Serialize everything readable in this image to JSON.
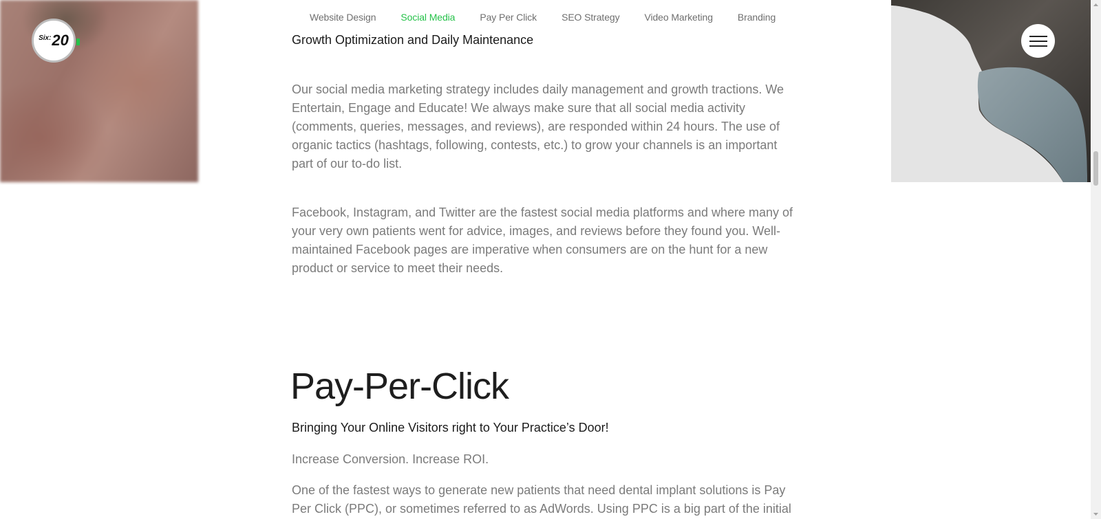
{
  "logo": {
    "prefix": "Six:",
    "number": "20"
  },
  "nav": {
    "items": [
      {
        "label": "Website Design"
      },
      {
        "label": "Social Media"
      },
      {
        "label": "Pay Per Click"
      },
      {
        "label": "SEO Strategy"
      },
      {
        "label": "Video Marketing"
      },
      {
        "label": "Branding"
      }
    ],
    "active_index": 1,
    "active_color": "#26c24a"
  },
  "menu_button": {
    "icon": "hamburger-icon"
  },
  "social_section": {
    "subheading": "Growth Optimization and Daily Maintenance",
    "paragraph_1": "Our social media marketing strategy includes daily management and growth tractions. We Entertain, Engage and Educate! We always make sure that all social media activity (comments, queries, messages, and reviews), are responded within 24 hours. The use of organic tactics (hashtags, following, contests, etc.) to grow your channels is an important part of our to-do list.",
    "paragraph_2": "Facebook, Instagram, and Twitter are the fastest social media platforms and where many of your very own patients went for advice, images, and reviews before they found you. Well-maintained Facebook pages are imperative when consumers are on the hunt for a new product or service to meet their needs."
  },
  "ppc_section": {
    "title": "Pay-Per-Click",
    "subtitle": "Bringing Your Online Visitors right to Your Practice’s Door!",
    "tagline": "Increase Conversion. Increase ROI.",
    "paragraph": "One of the fastest ways to generate new patients that need dental implant solutions is Pay Per Click (PPC), or sometimes referred to as AdWords. Using PPC is a big part of the initial"
  },
  "colors": {
    "accent": "#26c24a",
    "body_text": "#7b7b7b",
    "heading_text": "#1e1e1e"
  }
}
